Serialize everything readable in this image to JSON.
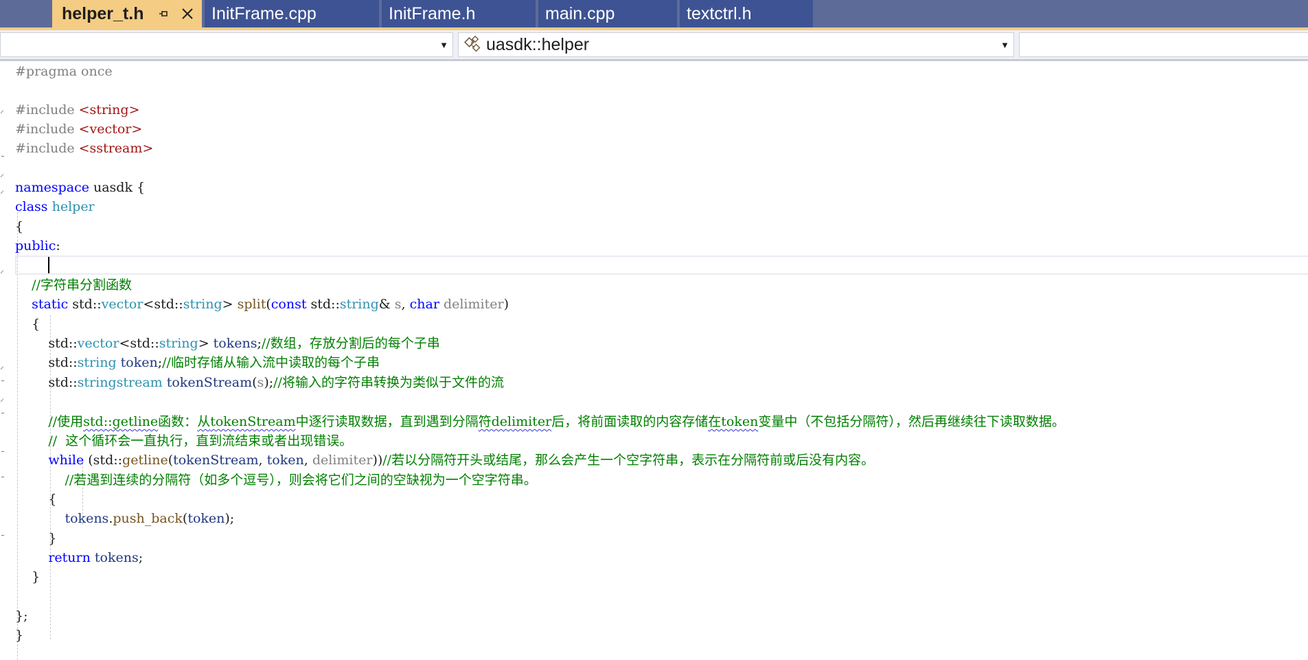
{
  "tabs": [
    {
      "label": "helper_t.h",
      "active": true
    },
    {
      "label": "InitFrame.cpp",
      "active": false
    },
    {
      "label": "InitFrame.h",
      "active": false
    },
    {
      "label": "main.cpp",
      "active": false
    },
    {
      "label": "textctrl.h",
      "active": false
    }
  ],
  "tab_icons": {
    "pin": "pin-icon",
    "close": "close-icon"
  },
  "nav": {
    "project_value": "",
    "scope_value": "uasdk::helper",
    "scope_icon": "class-icon",
    "member_value": ""
  },
  "colors": {
    "tab_active": "#f5cc84",
    "tab_inactive": "#3e5393",
    "tabstrip": "#5d6b99",
    "keyword": "#0000ff",
    "type": "#2b91af",
    "comment": "#008000",
    "preprocessor": "#808080",
    "include_path": "#a31515"
  },
  "code": {
    "l1": [
      "#pragma once"
    ],
    "l3": [
      "#include ",
      "<string>"
    ],
    "l4": [
      "#include ",
      "<vector>"
    ],
    "l5": [
      "#include ",
      "<sstream>"
    ],
    "l7": [
      "namespace",
      " uasdk {"
    ],
    "l8": [
      "class",
      " ",
      "helper"
    ],
    "l9": [
      "{"
    ],
    "l10": [
      "public",
      ":"
    ],
    "l12": [
      "    ",
      "//字符串分割函数"
    ],
    "l13": [
      "    ",
      "static",
      " std::",
      "vector",
      "<std::",
      "string",
      "> ",
      "split",
      "(",
      "const",
      " std::",
      "string",
      "& ",
      "s",
      ", ",
      "char",
      " ",
      "delimiter",
      ")"
    ],
    "l14": [
      "    {"
    ],
    "l15": [
      "        std::",
      "vector",
      "<std::",
      "string",
      "> ",
      "tokens",
      ";",
      "//数组，存放分割后的每个子串"
    ],
    "l16": [
      "        std::",
      "string",
      " ",
      "token",
      ";",
      "//临时存储从输入流中读取的每个子串"
    ],
    "l17": [
      "        std::",
      "stringstream",
      " ",
      "tokenStream",
      "(",
      "s",
      ");",
      "//将输入的字符串转换为类似于文件的流"
    ],
    "l19": [
      "        ",
      "//使用",
      "std::getline",
      "函数：",
      "从",
      "tokenStream",
      "中逐行读取数据，直到遇到分隔",
      "符delimiter",
      "后，将前面读取的内容存储",
      "在token",
      "变量中（不包括分隔符），然后再继续往下读取数据。"
    ],
    "l20": [
      "        ",
      "//  这个循环会一直执行，直到流结束或者出现错误。"
    ],
    "l21": [
      "        ",
      "while",
      " (std::",
      "getline",
      "(",
      "tokenStream",
      ", ",
      "token",
      ", ",
      "delimiter",
      "))",
      "//若以分隔符开头或结尾，那么会产生一个空字符串，表示在分隔符前或后没有内容。"
    ],
    "l22": [
      "            ",
      "//若遇到连续的分隔符（如多个逗号），则会将它们之间的空缺视为一个空字符串。"
    ],
    "l23": [
      "        {"
    ],
    "l24": [
      "            ",
      "tokens",
      ".",
      "push_back",
      "(",
      "token",
      ");"
    ],
    "l25": [
      "        }"
    ],
    "l26": [
      "        ",
      "return",
      " ",
      "tokens",
      ";"
    ],
    "l27": [
      "    }"
    ],
    "l29": [
      "};"
    ],
    "l30": [
      "}"
    ]
  }
}
